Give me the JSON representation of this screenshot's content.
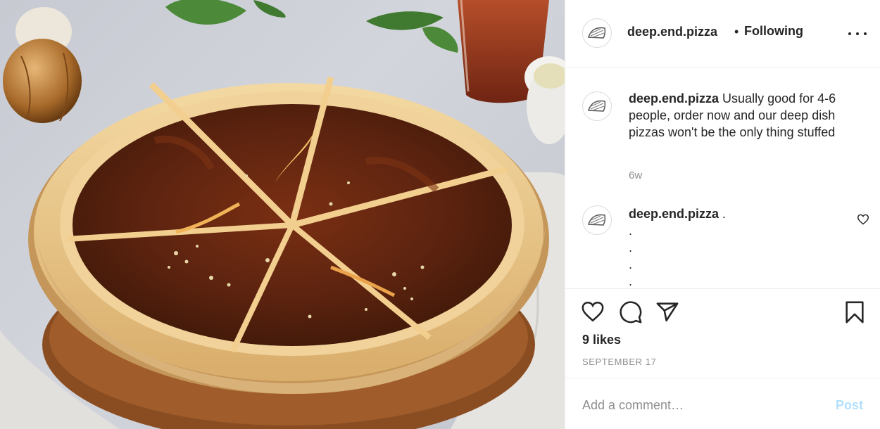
{
  "post": {
    "username": "deep.end.pizza",
    "dot": "•",
    "follow_status": "Following",
    "more_icon": "more-horizontal-icon"
  },
  "caption": {
    "username": "deep.end.pizza",
    "text": "Usually good for 4-6 people, order now and our deep dish pizzas won't be the only thing stuffed",
    "age": "6w"
  },
  "comment": {
    "username": "deep.end.pizza",
    "text": ".",
    "continuation": ".\n.\n.\n."
  },
  "actions": {
    "icons": [
      "heart-icon",
      "comment-icon",
      "share-icon",
      "bookmark-icon"
    ],
    "likes": "9 likes",
    "date": "SEPTEMBER 17"
  },
  "comment_input": {
    "placeholder": "Add a comment…",
    "post_label": "Post"
  },
  "colors": {
    "link_disabled": "#b2dffc",
    "secondary_text": "#8e8e8e",
    "border": "#efefef"
  }
}
